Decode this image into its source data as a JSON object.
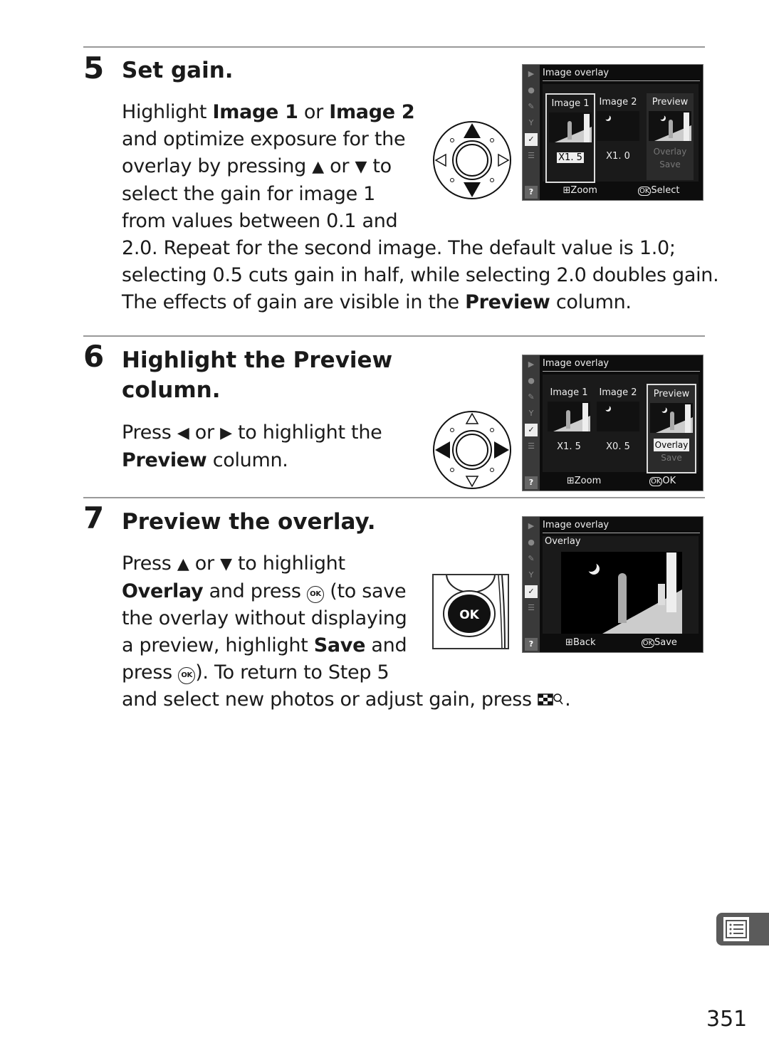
{
  "page_number": "351",
  "steps": [
    {
      "number": "5",
      "title": "Set gain.",
      "lines": [
        [
          {
            "t": "Highlight "
          },
          {
            "t": "Image 1",
            "b": true
          },
          {
            "t": " or "
          },
          {
            "t": "Image 2",
            "b": true
          }
        ],
        [
          {
            "t": "and optimize exposure for the"
          }
        ],
        [
          {
            "t": "overlay by pressing "
          },
          {
            "icon": "up"
          },
          {
            "t": " or "
          },
          {
            "icon": "down"
          },
          {
            "t": " to"
          }
        ],
        [
          {
            "t": "select the gain for image 1"
          }
        ],
        [
          {
            "t": "from values between 0.1 and"
          }
        ],
        [
          {
            "t": "2.0.  Repeat for the second image. The default value is 1.0;"
          }
        ],
        [
          {
            "t": "selecting 0.5 cuts gain in half, while selecting 2.0 doubles gain."
          }
        ],
        [
          {
            "t": "The effects of gain are visible in the "
          },
          {
            "t": "Preview",
            "b": true
          },
          {
            "t": " column."
          }
        ]
      ],
      "screen": {
        "header": "Image overlay",
        "columns": [
          "Image 1",
          "Image 2",
          "Preview"
        ],
        "gains": [
          "X1. 5",
          "X1. 0"
        ],
        "preview_options": [
          "Overlay",
          "Save"
        ],
        "footer_left": "Zoom",
        "footer_right": "Select"
      }
    },
    {
      "number": "6",
      "title_line1": "Highlight the Preview",
      "title_line2": "column.",
      "lines": [
        [
          {
            "t": "Press "
          },
          {
            "icon": "left"
          },
          {
            "t": " or "
          },
          {
            "icon": "right"
          },
          {
            "t": " to highlight the"
          }
        ],
        [
          {
            "t": "Preview",
            "b": true
          },
          {
            "t": " column."
          }
        ]
      ],
      "screen": {
        "header": "Image overlay",
        "columns": [
          "Image 1",
          "Image 2",
          "Preview"
        ],
        "gains": [
          "X1. 5",
          "X0. 5"
        ],
        "preview_options": [
          "Overlay",
          "Save"
        ],
        "footer_left": "Zoom",
        "footer_right": "OK"
      }
    },
    {
      "number": "7",
      "title": "Preview the overlay.",
      "lines": [
        [
          {
            "t": "Press "
          },
          {
            "icon": "up"
          },
          {
            "t": " or "
          },
          {
            "icon": "down"
          },
          {
            "t": " to highlight"
          }
        ],
        [
          {
            "t": "Overlay",
            "b": true
          },
          {
            "t": " and press "
          },
          {
            "icon": "ok"
          },
          {
            "t": " (to save"
          }
        ],
        [
          {
            "t": "the overlay without displaying"
          }
        ],
        [
          {
            "t": "a preview, highlight "
          },
          {
            "t": "Save",
            "b": true
          },
          {
            "t": " and"
          }
        ],
        [
          {
            "t": "press "
          },
          {
            "icon": "ok"
          },
          {
            "t": ").  To return to Step 5"
          }
        ],
        [
          {
            "t": "and select new photos or adjust gain, press "
          },
          {
            "icon": "zoom"
          },
          {
            "t": "."
          }
        ]
      ],
      "screen": {
        "header": "Image overlay",
        "subheader": "Overlay",
        "footer_left": "Back",
        "footer_right": "Save"
      },
      "ok_button_label": "OK"
    }
  ],
  "icons": {
    "up": "▲",
    "down": "▼",
    "left": "◀",
    "right": "▶",
    "ok": "OK",
    "footer_ok": "OK"
  }
}
